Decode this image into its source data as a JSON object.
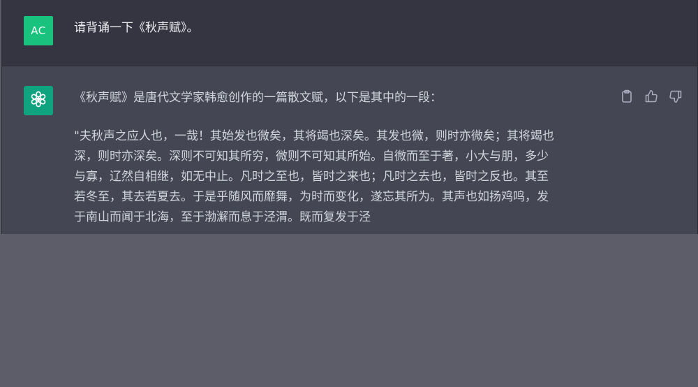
{
  "user_message": {
    "avatar_initials": "AC",
    "text": "请背诵一下《秋声赋》。"
  },
  "assistant_message": {
    "intro": "《秋声赋》是唐代文学家韩愈创作的一篇散文赋，以下是其中的一段：",
    "poem_lines": [
      "\"夫秋声之应人也，一哉！其始发也微矣，其将竭也深矣。其发也微，则时亦微矣；其将竭也",
      "深，则时亦深矣。深则不可知其所穷，微则不可知其所始。自微而至于著，小大与朋，多少",
      "与寡，辽然自相继，如无中止。凡时之至也，皆时之来也；凡时之去也，皆时之反也。其至",
      "若冬至，其去若夏去。于是乎随风而靡舞，为时而变化，遂忘其所为。其声也如扬鸡鸣，发",
      "于南山而闻于北海，至于渤澥而息于泾渭。既而复发于泾"
    ]
  },
  "icons": {
    "assistant_avatar": "openai-logo-icon",
    "copy": "clipboard-icon",
    "like": "thumbs-up-icon",
    "dislike": "thumbs-down-icon"
  },
  "colors": {
    "user_bg": "#343541",
    "assistant_bg": "#444654",
    "user_avatar": "#19c37d",
    "assistant_avatar": "#10a37f",
    "outside_bg": "#5c5d69"
  }
}
